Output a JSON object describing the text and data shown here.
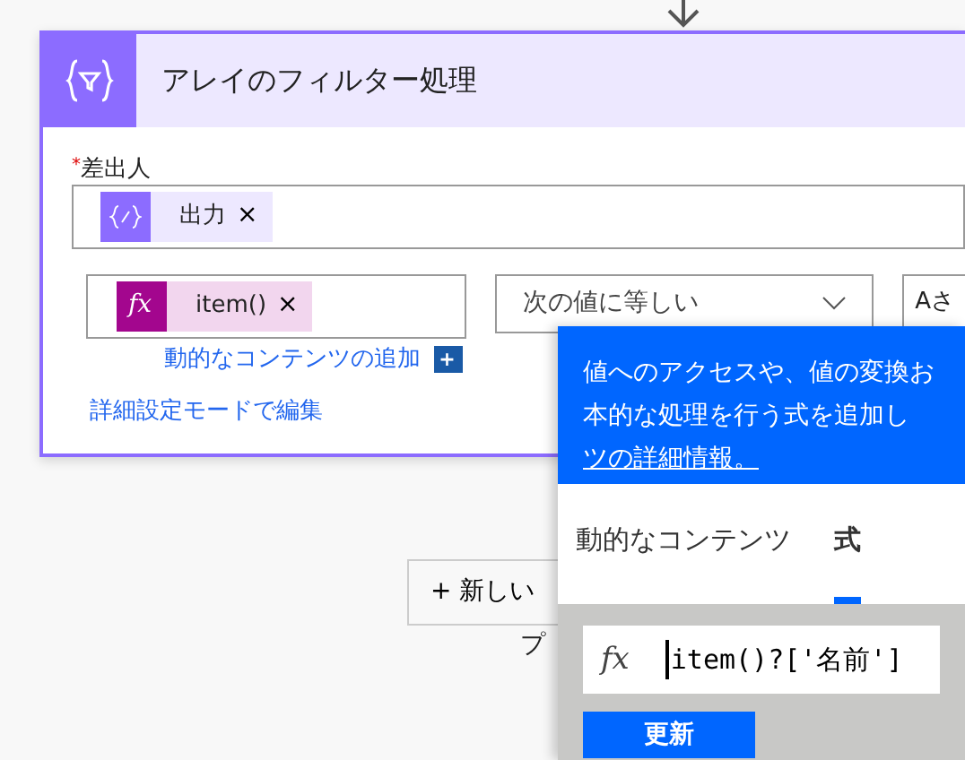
{
  "action": {
    "title": "アレイのフィルター処理",
    "from_label": "差出人",
    "required_mark": "*",
    "from_token": {
      "label": "出力",
      "remove": "×"
    },
    "condition": {
      "left_token": {
        "icon": "fx",
        "label": "item()",
        "remove": "×"
      },
      "operator": "次の値に等しい",
      "right_value": "Aさ"
    },
    "add_dynamic": "動的なコンテンツの追加",
    "add_button": "+",
    "advanced_link": "詳細設定モードで編集"
  },
  "new_step": {
    "label": "+ 新しい",
    "below": "プ"
  },
  "popover": {
    "lines": [
      "値へのアクセスや、値の変換お",
      "本的な処理を行う式を追加し"
    ],
    "link": "ツの詳細情報。",
    "tabs": [
      {
        "label": "動的なコンテンツ",
        "selected": false
      },
      {
        "label": "式",
        "selected": true
      }
    ],
    "expression_icon": "fx",
    "expression": "item()?['名前']",
    "button": "更新"
  }
}
